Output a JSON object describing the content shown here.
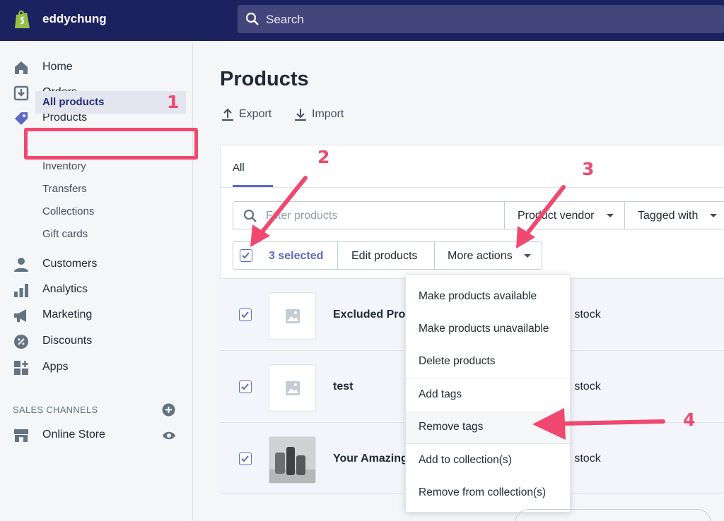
{
  "header": {
    "store_name": "eddychung",
    "search_placeholder": "Search"
  },
  "sidebar": {
    "items": [
      {
        "label": "Home"
      },
      {
        "label": "Orders"
      },
      {
        "label": "Products"
      },
      {
        "label": "Customers"
      },
      {
        "label": "Analytics"
      },
      {
        "label": "Marketing"
      },
      {
        "label": "Discounts"
      },
      {
        "label": "Apps"
      }
    ],
    "product_sub": [
      "All products",
      "Inventory",
      "Transfers",
      "Collections",
      "Gift cards"
    ],
    "sales_channels_title": "SALES CHANNELS",
    "online_store": "Online Store"
  },
  "main": {
    "title": "Products",
    "export_label": "Export",
    "import_label": "Import",
    "tab_all": "All",
    "filter_placeholder": "Filter products",
    "vendor_label": "Product vendor",
    "tagged_label": "Tagged with",
    "selected_label": "3 selected",
    "edit_label": "Edit products",
    "more_actions_label": "More actions",
    "rows": [
      {
        "title": "Excluded Prod",
        "stock": "n stock"
      },
      {
        "title": "test",
        "stock": "n stock"
      },
      {
        "title": "Your Amazing",
        "stock": "n stock"
      }
    ]
  },
  "menu": {
    "items": [
      "Make products available",
      "Make products unavailable",
      "Delete products",
      "Add tags",
      "Remove tags",
      "Add to collection(s)",
      "Remove from collection(s)"
    ]
  },
  "annotations": {
    "n1": "1",
    "n2": "2",
    "n3": "3",
    "n4": "4"
  },
  "colors": {
    "accent": "#5c6ac4",
    "topbar": "#1c2260",
    "annotation": "#f0486e"
  }
}
